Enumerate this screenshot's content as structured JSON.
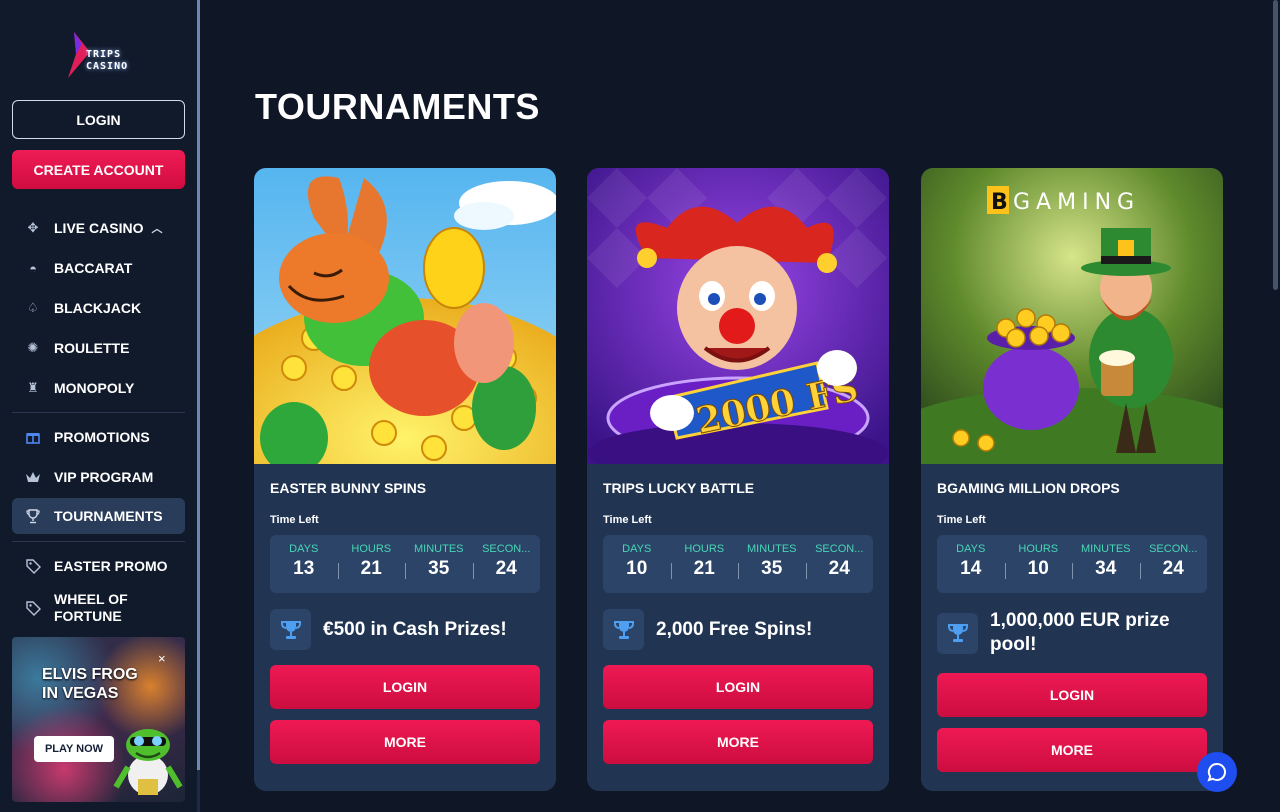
{
  "brand": {
    "logo_line1": "TRIPS",
    "logo_line2": "CASINO"
  },
  "sidebar": {
    "login_label": "LOGIN",
    "create_account_label": "CREATE ACCOUNT",
    "items": [
      {
        "label": "LIVE CASINO",
        "icon": "cards-icon"
      },
      {
        "label": "BACCARAT",
        "icon": "baccarat-icon"
      },
      {
        "label": "BLACKJACK",
        "icon": "blackjack-icon"
      },
      {
        "label": "ROULETTE",
        "icon": "roulette-icon"
      },
      {
        "label": "MONOPOLY",
        "icon": "monopoly-icon"
      },
      {
        "label": "PROMOTIONS",
        "icon": "gift-icon"
      },
      {
        "label": "VIP PROGRAM",
        "icon": "crown-icon"
      },
      {
        "label": "TOURNAMENTS",
        "icon": "trophy-icon"
      },
      {
        "label": "EASTER PROMO",
        "icon": "tag-icon"
      },
      {
        "label": "WHEEL OF FORTUNE",
        "icon": "tag-icon"
      }
    ],
    "promo": {
      "title_line1": "ELVIS FROG",
      "title_line2": "IN VEGAS",
      "close": "×",
      "cta": "PLAY NOW"
    }
  },
  "main": {
    "title": "TOURNAMENTS",
    "time_left_label": "Time Left",
    "countdown_labels": {
      "days": "DAYS",
      "hours": "HOURS",
      "minutes": "MINUTES",
      "seconds": "SECON..."
    },
    "cards": [
      {
        "name": "EASTER BUNNY SPINS",
        "days": "13",
        "hours": "21",
        "minutes": "35",
        "seconds": "24",
        "prize": "€500 in Cash Prizes!",
        "login_label": "LOGIN",
        "more_label": "MORE"
      },
      {
        "name": "TRIPS LUCKY BATTLE",
        "banner": "2000 FS",
        "days": "10",
        "hours": "21",
        "minutes": "35",
        "seconds": "24",
        "prize": "2,000 Free Spins!",
        "login_label": "LOGIN",
        "more_label": "MORE"
      },
      {
        "name": "BGAMING MILLION DROPS",
        "provider": "BGAMING",
        "days": "14",
        "hours": "10",
        "minutes": "34",
        "seconds": "24",
        "prize": "1,000,000 EUR prize pool!",
        "login_label": "LOGIN",
        "more_label": "MORE"
      }
    ]
  },
  "colors": {
    "accent": "#e8154d",
    "background": "#0f1626",
    "card": "#213553",
    "countdown_label": "#47d7b5",
    "chat": "#1f4ef0"
  }
}
